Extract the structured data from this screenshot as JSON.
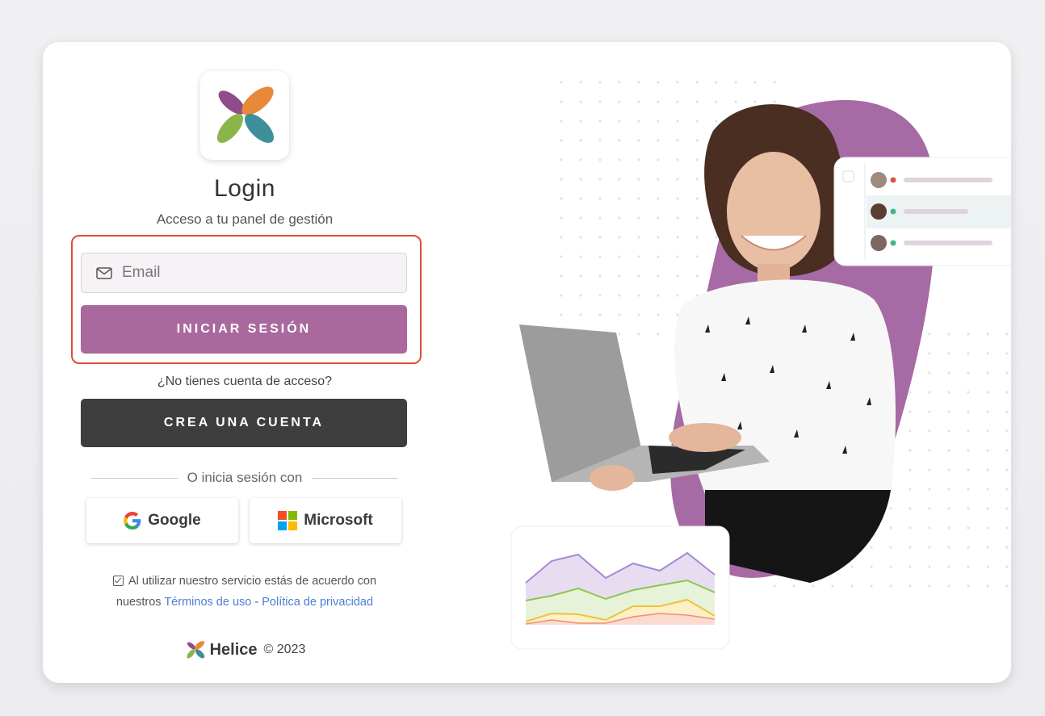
{
  "login": {
    "title": "Login",
    "subtitle": "Acceso a tu panel de gestión",
    "email_placeholder": "Email",
    "login_button": "INICIAR SESIÓN",
    "no_account": "¿No tienes cuenta de acceso?",
    "create_button": "CREA UNA CUENTA",
    "divider_text": "O inicia sesión con",
    "google_label": "Google",
    "microsoft_label": "Microsoft",
    "terms_prefix": "Al utilizar nuestro servicio estás de acuerdo con",
    "terms_line2_prefix": "nuestros",
    "terms_link": "Términos de uso",
    "terms_sep": "-",
    "privacy_link": "Política de privacidad"
  },
  "footer": {
    "brand": "Helice",
    "copyright": "© 2023"
  },
  "colors": {
    "accent": "#a9699d",
    "dark_button": "#3e3e3e",
    "highlight": "#e04b3b",
    "link": "#4a7fd0"
  },
  "icons": [
    "helice-logo-icon",
    "mail-icon",
    "google-icon",
    "microsoft-icon",
    "checkbox-icon"
  ]
}
